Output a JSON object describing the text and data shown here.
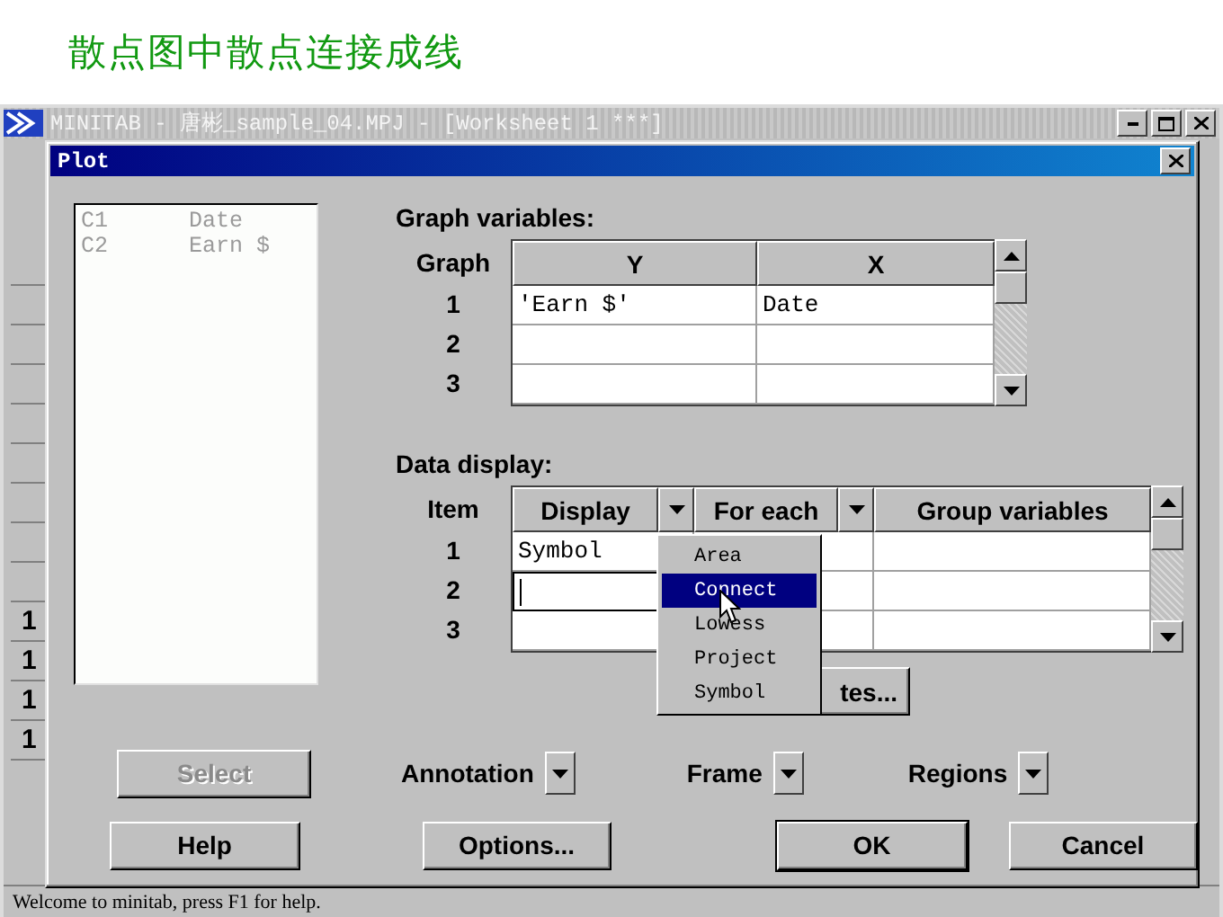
{
  "slide_title": "散点图中散点连接成线",
  "main_window": {
    "title": "MINITAB - 唐彬_sample_04.MPJ - [Worksheet 1 ***]",
    "row_headers": [
      "1",
      "1",
      "1",
      "1"
    ],
    "status_bar": "Welcome to minitab, press F1 for help."
  },
  "dialog": {
    "title": "Plot",
    "variables": [
      {
        "column": "C1",
        "name": "Date"
      },
      {
        "column": "C2",
        "name": "Earn $"
      }
    ],
    "select_button": {
      "label": "Select",
      "disabled": true
    },
    "graph_variables": {
      "label": "Graph variables:",
      "row_label": "Graph",
      "columns": [
        "Y",
        "X"
      ],
      "rows": [
        {
          "item": "1",
          "cells": [
            "'Earn $'",
            "Date"
          ]
        },
        {
          "item": "2",
          "cells": []
        },
        {
          "item": "3",
          "cells": []
        }
      ]
    },
    "data_display": {
      "label": "Data display:",
      "row_label": "Item",
      "columns": [
        {
          "label": "Display",
          "dropdown": true
        },
        {
          "label": "For each",
          "dropdown": true
        },
        {
          "label": "Group variables",
          "dropdown": false
        }
      ],
      "rows": [
        {
          "item": "1",
          "display": "Symbol",
          "editing": false
        },
        {
          "item": "2",
          "editing": true
        },
        {
          "item": "3",
          "editing": false
        }
      ],
      "menu": [
        {
          "label": "Area",
          "selected": false
        },
        {
          "label": "Connect",
          "selected": true
        },
        {
          "label": "Lowess",
          "selected": false
        },
        {
          "label": "Project",
          "selected": false
        },
        {
          "label": "Symbol",
          "selected": false
        }
      ],
      "covered_button": "tes..."
    },
    "dropdowns": [
      {
        "label": "Annotation"
      },
      {
        "label": "Frame"
      },
      {
        "label": "Regions"
      }
    ],
    "buttons": [
      {
        "label": "Help",
        "default": false
      },
      {
        "label": "Options...",
        "default": false
      },
      {
        "label": "OK",
        "default": true
      },
      {
        "label": "Cancel",
        "default": false
      }
    ]
  }
}
